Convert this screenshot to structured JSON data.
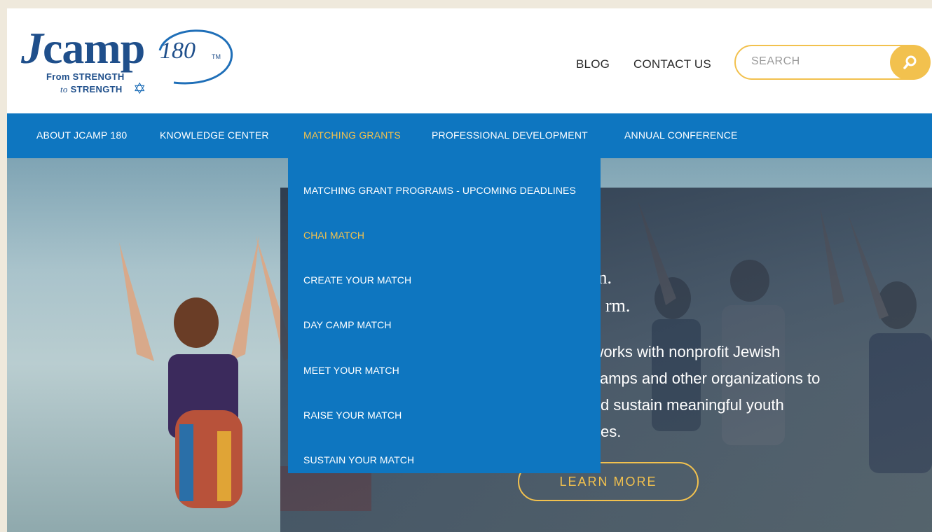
{
  "logo": {
    "word_j": "J",
    "word_rest": "camp",
    "number": "180",
    "tm": "TM",
    "tagline_line1": "From STRENGTH",
    "tagline_to": "to",
    "tagline_line2": "STRENGTH",
    "star": "✡"
  },
  "header": {
    "blog": "BLOG",
    "contact": "CONTACT US",
    "search_placeholder": "SEARCH"
  },
  "nav": {
    "items": [
      {
        "label": "ABOUT JCAMP 180"
      },
      {
        "label": "KNOWLEDGE CENTER"
      },
      {
        "label": "MATCHING GRANTS"
      },
      {
        "label": "PROFESSIONAL DEVELOPMENT"
      },
      {
        "label": "ANNUAL CONFERENCE"
      }
    ]
  },
  "dropdown": {
    "items": [
      {
        "label": "MATCHING GRANT PROGRAMS - UPCOMING DEADLINES"
      },
      {
        "label": "CHAI MATCH"
      },
      {
        "label": "CREATE YOUR MATCH"
      },
      {
        "label": "DAY CAMP MATCH"
      },
      {
        "label": "MEET YOUR MATCH"
      },
      {
        "label": "RAISE YOUR MATCH"
      },
      {
        "label": "SUSTAIN YOUR MATCH"
      }
    ]
  },
  "hero": {
    "heading_line1": "en.",
    "heading_line2": "rm.",
    "body_line1": ") works with nonprofit Jewish",
    "body_line2": "amps and other organizations to",
    "body_line3": "d sustain meaningful youth",
    "body_line4": "es.",
    "cta": "LEARN MORE"
  },
  "colors": {
    "brand_blue": "#0e76c0",
    "accent_gold": "#f2c14e",
    "logo_navy": "#1f4f8b"
  }
}
